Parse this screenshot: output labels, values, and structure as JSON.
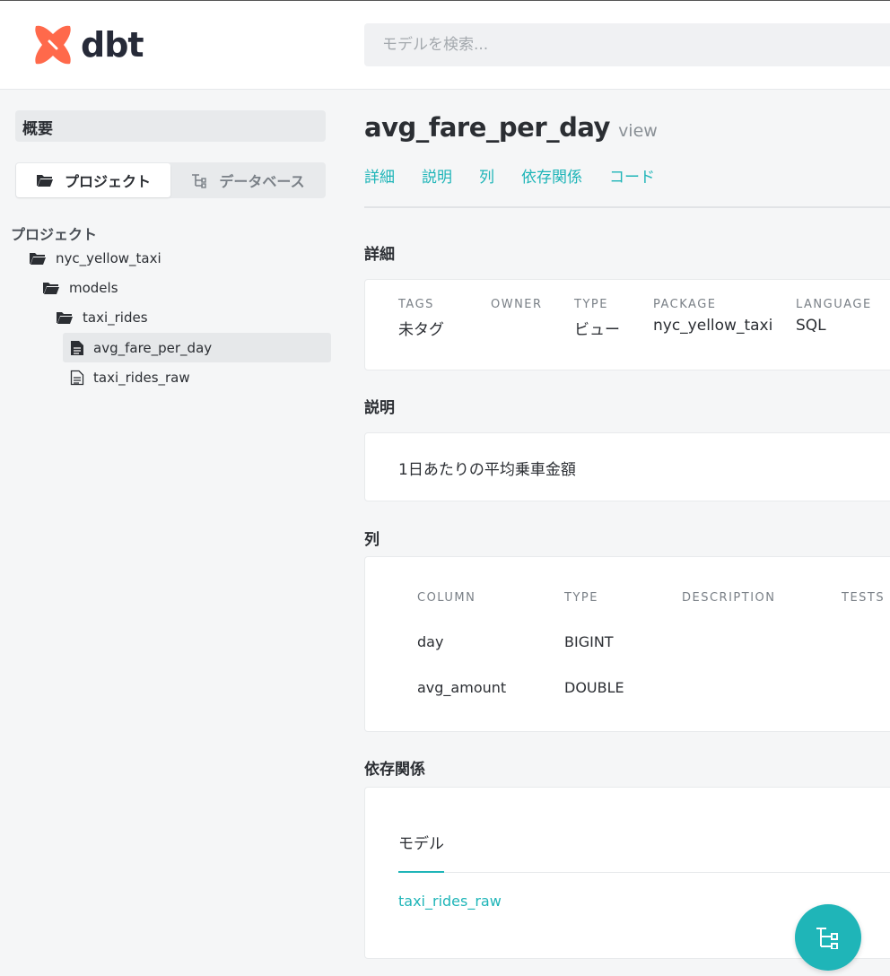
{
  "header": {
    "brand": "dbt",
    "search_placeholder": "モデルを検索..."
  },
  "sidebar": {
    "overview": "概要",
    "tabs": [
      {
        "label": "プロジェクト",
        "icon": "folder-open-icon",
        "active": true
      },
      {
        "label": "データベース",
        "icon": "database-tree-icon",
        "active": false
      }
    ],
    "tree_heading": "プロジェクト",
    "tree": [
      {
        "label": "nyc_yellow_taxi",
        "icon": "folder-open-icon",
        "depth": 1,
        "selected": false
      },
      {
        "label": "models",
        "icon": "folder-open-icon",
        "depth": 2,
        "selected": false
      },
      {
        "label": "taxi_rides",
        "icon": "folder-open-icon",
        "depth": 3,
        "selected": false
      },
      {
        "label": "avg_fare_per_day",
        "icon": "file-filled-icon",
        "depth": 4,
        "selected": true
      },
      {
        "label": "taxi_rides_raw",
        "icon": "file-outline-icon",
        "depth": 4,
        "selected": false
      }
    ]
  },
  "main": {
    "title": "avg_fare_per_day",
    "kind": "view",
    "nav": [
      "詳細",
      "説明",
      "列",
      "依存関係",
      "コード"
    ],
    "details": {
      "heading": "詳細",
      "fields": [
        {
          "label": "TAGS",
          "value": "未タグ"
        },
        {
          "label": "OWNER",
          "value": ""
        },
        {
          "label": "TYPE",
          "value": "ビュー"
        },
        {
          "label": "PACKAGE",
          "value": "nyc_yellow_taxi"
        },
        {
          "label": "LANGUAGE",
          "value": "SQL"
        }
      ]
    },
    "description": {
      "heading": "説明",
      "text": "1日あたりの平均乗車金額"
    },
    "columns": {
      "heading": "列",
      "headers": [
        "COLUMN",
        "TYPE",
        "DESCRIPTION",
        "TESTS"
      ],
      "rows": [
        {
          "column": "day",
          "type": "BIGINT"
        },
        {
          "column": "avg_amount",
          "type": "DOUBLE"
        }
      ]
    },
    "dependencies": {
      "heading": "依存関係",
      "tab": "モデル",
      "items": [
        "taxi_rides_raw"
      ]
    }
  },
  "colors": {
    "accent": "#1fb5b8",
    "brand": "#ff694b"
  },
  "fab": {
    "icon": "lineage-graph-icon"
  }
}
